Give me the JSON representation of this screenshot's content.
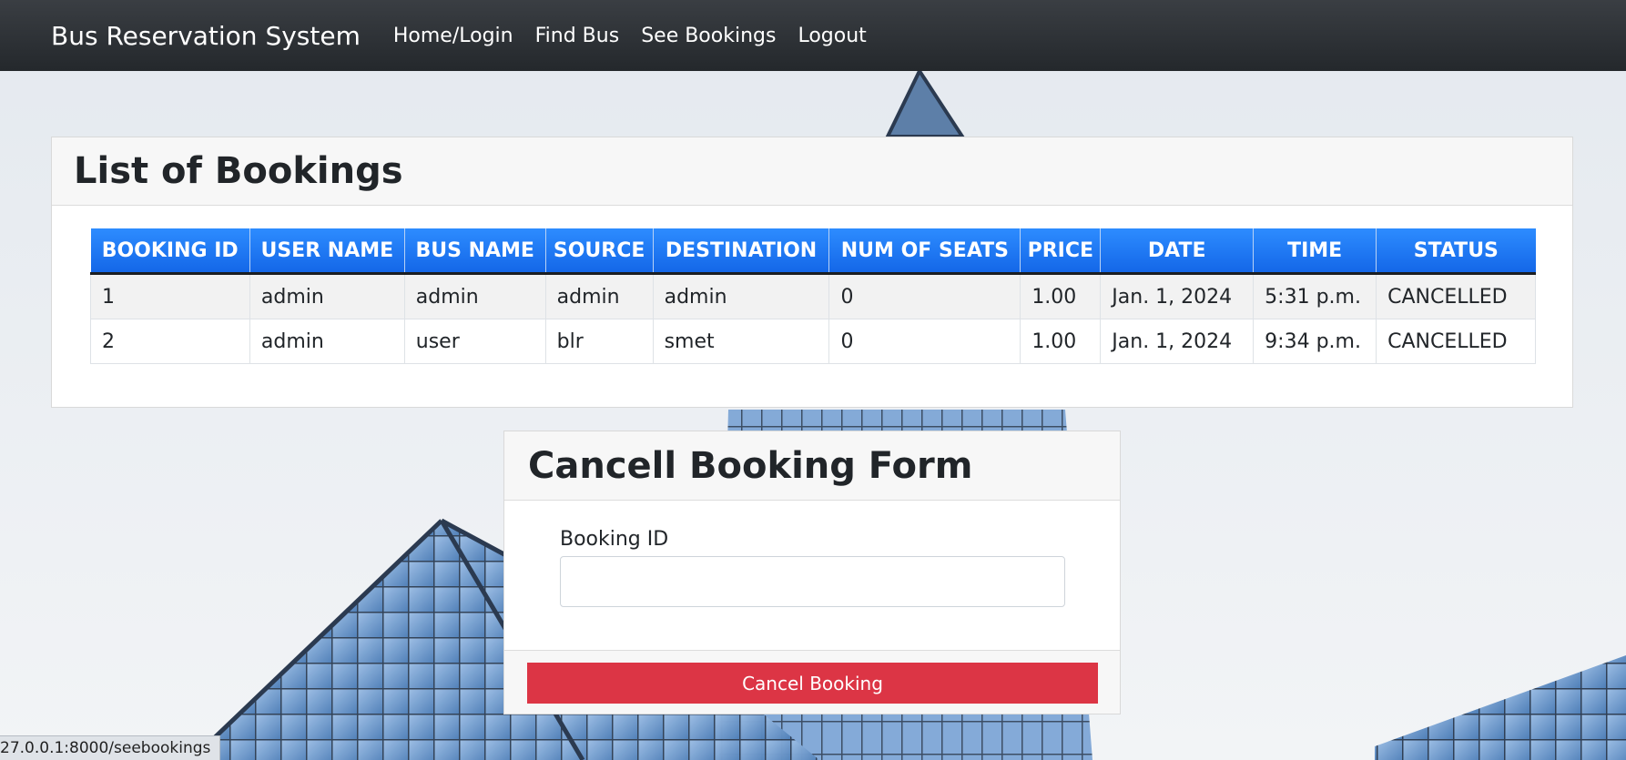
{
  "navbar": {
    "brand": "Bus Reservation System",
    "links": [
      "Home/Login",
      "Find Bus",
      "See Bookings",
      "Logout"
    ]
  },
  "bookings_card": {
    "title": "List of Bookings",
    "columns": [
      "BOOKING ID",
      "USER NAME",
      "BUS NAME",
      "SOURCE",
      "DESTINATION",
      "NUM OF SEATS",
      "PRICE",
      "DATE",
      "TIME",
      "STATUS"
    ],
    "rows": [
      [
        "1",
        "admin",
        "admin",
        "admin",
        "admin",
        "0",
        "1.00",
        "Jan. 1, 2024",
        "5:31 p.m.",
        "CANCELLED"
      ],
      [
        "2",
        "admin",
        "user",
        "blr",
        "smet",
        "0",
        "1.00",
        "Jan. 1, 2024",
        "9:34 p.m.",
        "CANCELLED"
      ]
    ]
  },
  "cancel_form": {
    "title": "Cancell Booking Form",
    "booking_id_label": "Booking ID",
    "booking_id_value": "",
    "submit_label": "Cancel Booking"
  },
  "status_bar": {
    "url": "27.0.0.1:8000/seebookings"
  },
  "colors": {
    "navbar": "#24282c",
    "table_header": "#1a73f0",
    "danger_button": "#dc3545"
  }
}
